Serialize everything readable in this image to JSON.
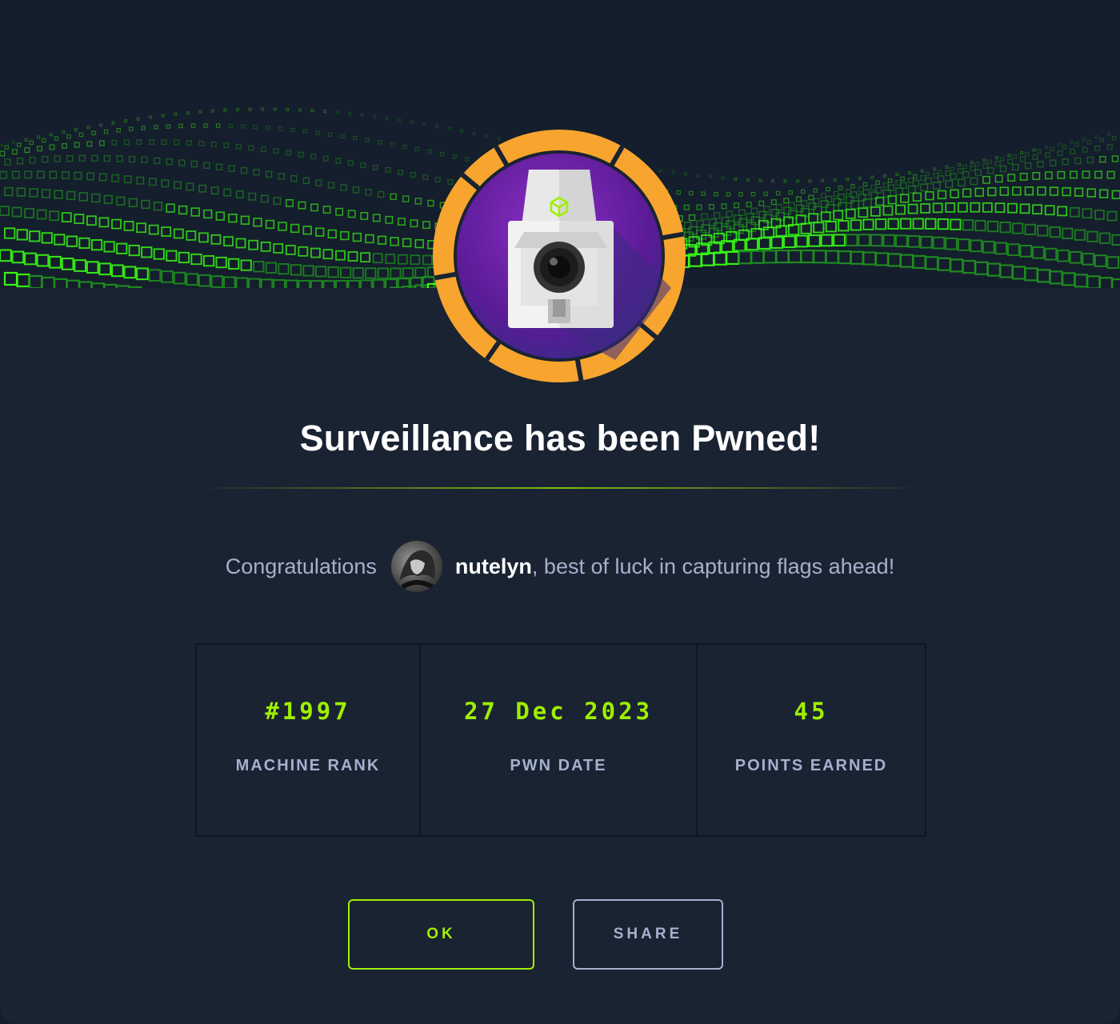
{
  "modal": {
    "machine_name": "Surveillance",
    "title": "Surveillance has been Pwned!",
    "congrats_prefix": "Congratulations",
    "username": "nutelyn",
    "congrats_suffix": ", best of luck in capturing flags ahead!"
  },
  "stats": [
    {
      "value": "#1997",
      "label": "MACHINE RANK"
    },
    {
      "value": "27 Dec 2023",
      "label": "PWN DATE"
    },
    {
      "value": "45",
      "label": "POINTS EARNED"
    }
  ],
  "buttons": {
    "ok_label": "OK",
    "share_label": "SHARE"
  },
  "colors": {
    "background": "#1a2332",
    "accent": "#9fef00",
    "muted_text": "#a4b1cd",
    "badge_ring": "#f5a623",
    "badge_inner": "#6a1fa0"
  },
  "icons": {
    "badge": "security-camera-icon",
    "hex_logo": "hackthebox-cube-icon"
  }
}
